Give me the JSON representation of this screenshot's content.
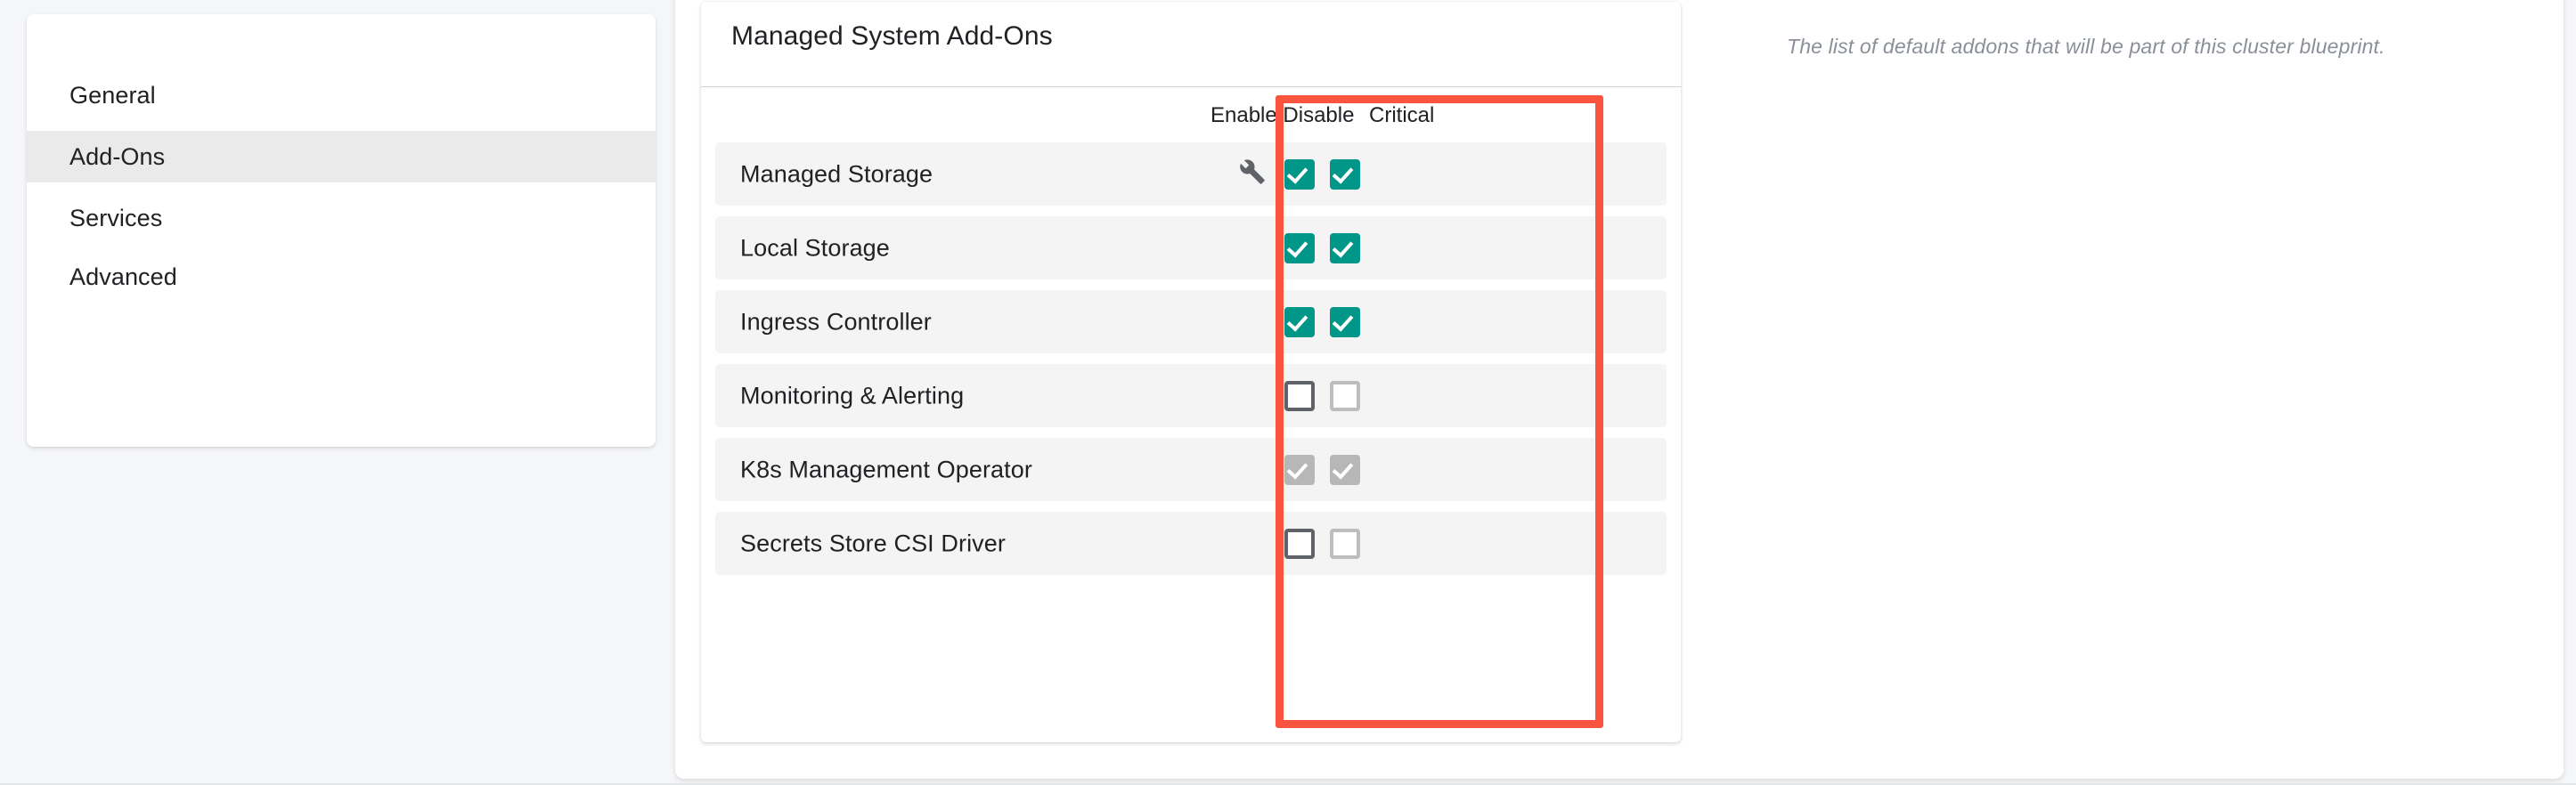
{
  "sidebar": {
    "items": [
      {
        "label": "General",
        "active": false
      },
      {
        "label": "Add-Ons",
        "active": true
      },
      {
        "label": "Services",
        "active": false
      },
      {
        "label": "Advanced",
        "active": false
      }
    ]
  },
  "addons_panel": {
    "title": "Managed System Add-Ons",
    "columns": {
      "name": "",
      "enable_disable": "Enable/Disable",
      "critical": "Critical"
    },
    "rows": [
      {
        "name": "Managed Storage",
        "has_config_icon": true,
        "config_icon": "wrench-icon",
        "enable_state": "checked",
        "critical_state": "checked"
      },
      {
        "name": "Local Storage",
        "has_config_icon": false,
        "config_icon": "",
        "enable_state": "checked",
        "critical_state": "checked"
      },
      {
        "name": "Ingress Controller",
        "has_config_icon": false,
        "config_icon": "",
        "enable_state": "checked",
        "critical_state": "checked"
      },
      {
        "name": "Monitoring & Alerting",
        "has_config_icon": false,
        "config_icon": "",
        "enable_state": "unchecked",
        "critical_state": "unchecked-disabled"
      },
      {
        "name": "K8s Management Operator",
        "has_config_icon": false,
        "config_icon": "",
        "enable_state": "checked-disabled",
        "critical_state": "checked-disabled"
      },
      {
        "name": "Secrets Store CSI Driver",
        "has_config_icon": false,
        "config_icon": "",
        "enable_state": "unchecked",
        "critical_state": "unchecked-disabled"
      }
    ]
  },
  "side_note": {
    "text": "The list of default addons that will be part of this cluster blueprint."
  },
  "highlight": {
    "name": "red-annotation-box",
    "color": "#f9543f"
  },
  "colors": {
    "checkbox_checked": "#009688",
    "checkbox_disabled": "#b7b7b7",
    "checkbox_border": "#5f6368",
    "checkbox_border_disabled": "#bdbdbd",
    "row_background": "#f4f4f4",
    "sidebar_active": "#eaeaea",
    "page_background": "#f5f6f8",
    "annotation": "#f9543f"
  }
}
